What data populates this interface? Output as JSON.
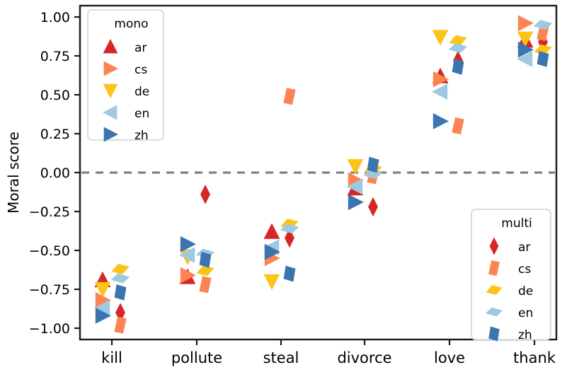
{
  "chart_data": {
    "type": "scatter",
    "title": "",
    "xlabel": "",
    "ylabel": "Moral score",
    "categories": [
      "kill",
      "pollute",
      "steal",
      "divorce",
      "love",
      "thank"
    ],
    "ylim": [
      -1.08,
      1.08
    ],
    "yticks": [
      1.0,
      0.75,
      0.5,
      0.25,
      0.0,
      -0.25,
      -0.5,
      -0.75,
      -1.0
    ],
    "ytick_labels": [
      "1.00",
      "0.75",
      "0.50",
      "0.25",
      "0.00",
      "−0.25",
      "−0.50",
      "−0.75",
      "−1.00"
    ],
    "grid": false,
    "reference_line": {
      "y": 0.0,
      "style": "dashed",
      "color": "#808080"
    },
    "legends": [
      {
        "title": "mono",
        "position": "upper-left",
        "entries": [
          {
            "name": "ar",
            "color": "#d62728",
            "marker": "triangle-up"
          },
          {
            "name": "cs",
            "color": "#fc8452",
            "marker": "triangle-right"
          },
          {
            "name": "de",
            "color": "#fcc419",
            "marker": "triangle-down"
          },
          {
            "name": "en",
            "color": "#9ecae1",
            "marker": "triangle-left"
          },
          {
            "name": "zh",
            "color": "#3b75af",
            "marker": "triangle-right"
          }
        ]
      },
      {
        "title": "multi",
        "position": "lower-right",
        "entries": [
          {
            "name": "ar",
            "color": "#d62728",
            "marker": "diamond-thin"
          },
          {
            "name": "cs",
            "color": "#fc8452",
            "marker": "parallelogram-tall"
          },
          {
            "name": "de",
            "color": "#fcc419",
            "marker": "parallelogram-wide"
          },
          {
            "name": "en",
            "color": "#9ecae1",
            "marker": "parallelogram-flat"
          },
          {
            "name": "zh",
            "color": "#3b75af",
            "marker": "parallelogram-slant"
          }
        ]
      }
    ],
    "series": [
      {
        "name": "mono-ar",
        "group": "mono",
        "lang": "ar",
        "color": "#d62728",
        "marker": "triangle-up",
        "values": [
          -0.69,
          -0.67,
          -0.38,
          -0.1,
          0.62,
          0.85
        ]
      },
      {
        "name": "mono-cs",
        "group": "mono",
        "lang": "cs",
        "color": "#fc8452",
        "marker": "triangle-right",
        "values": [
          -0.82,
          -0.66,
          -0.55,
          -0.05,
          0.6,
          0.96
        ]
      },
      {
        "name": "mono-de",
        "group": "mono",
        "lang": "de",
        "color": "#fcc419",
        "marker": "triangle-down",
        "values": [
          -0.75,
          -0.54,
          -0.7,
          0.04,
          0.87,
          0.86
        ]
      },
      {
        "name": "mono-en",
        "group": "mono",
        "lang": "en",
        "color": "#9ecae1",
        "marker": "triangle-left",
        "values": [
          -0.87,
          -0.53,
          -0.48,
          -0.09,
          0.52,
          0.73
        ]
      },
      {
        "name": "mono-zh",
        "group": "mono",
        "lang": "zh",
        "color": "#3b75af",
        "marker": "triangle-right",
        "values": [
          -0.92,
          -0.46,
          -0.51,
          -0.19,
          0.33,
          0.79
        ]
      },
      {
        "name": "multi-ar",
        "group": "multi",
        "lang": "ar",
        "color": "#d62728",
        "marker": "diamond-thin",
        "values": [
          -0.9,
          -0.14,
          -0.42,
          -0.22,
          0.72,
          0.84
        ]
      },
      {
        "name": "multi-cs",
        "group": "multi",
        "lang": "cs",
        "color": "#fc8452",
        "marker": "parallelogram-tall",
        "values": [
          -0.98,
          -0.72,
          0.49,
          -0.02,
          0.3,
          0.9
        ]
      },
      {
        "name": "multi-de",
        "group": "multi",
        "lang": "de",
        "color": "#fcc419",
        "marker": "parallelogram-wide",
        "values": [
          -0.62,
          -0.63,
          -0.33,
          0.02,
          0.85,
          0.79
        ]
      },
      {
        "name": "multi-en",
        "group": "multi",
        "lang": "en",
        "color": "#9ecae1",
        "marker": "parallelogram-flat",
        "values": [
          -0.68,
          -0.52,
          -0.36,
          -0.01,
          0.8,
          0.95
        ]
      },
      {
        "name": "multi-zh",
        "group": "multi",
        "lang": "zh",
        "color": "#3b75af",
        "marker": "parallelogram-slant",
        "values": [
          -0.77,
          -0.56,
          -0.65,
          0.05,
          0.68,
          0.73
        ]
      }
    ]
  }
}
